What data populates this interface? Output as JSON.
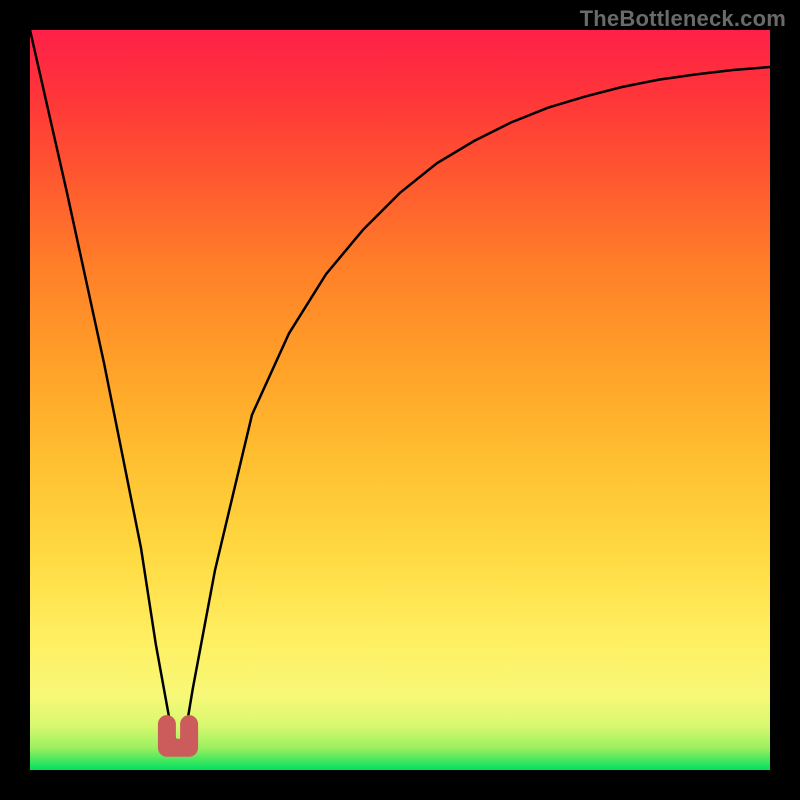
{
  "watermark": "TheBottleneck.com",
  "colors": {
    "frame": "#000000",
    "curve": "#000000",
    "marker": "#cc5c5c",
    "gradient_top": "#ff2048",
    "gradient_bottom": "#00e060"
  },
  "chart_data": {
    "type": "line",
    "title": "",
    "xlabel": "",
    "ylabel": "",
    "xlim": [
      0,
      100
    ],
    "ylim": [
      0,
      100
    ],
    "grid": false,
    "series": [
      {
        "name": "bottleneck-curve",
        "x": [
          0,
          5,
          10,
          15,
          17,
          19,
          20,
          21,
          22,
          25,
          30,
          35,
          40,
          45,
          50,
          55,
          60,
          65,
          70,
          75,
          80,
          85,
          90,
          95,
          100
        ],
        "values": [
          100,
          78,
          55,
          30,
          17,
          6,
          3,
          5,
          11,
          27,
          48,
          59,
          67,
          73,
          78,
          82,
          85,
          87.5,
          89.5,
          91,
          92.3,
          93.3,
          94,
          94.6,
          95
        ]
      }
    ],
    "marker": {
      "name": "optimal-point",
      "x_range": [
        18.5,
        21.5
      ],
      "y": 3
    },
    "background": {
      "type": "vertical-gradient",
      "low_color_meaning": "good",
      "high_color_meaning": "bad"
    }
  }
}
